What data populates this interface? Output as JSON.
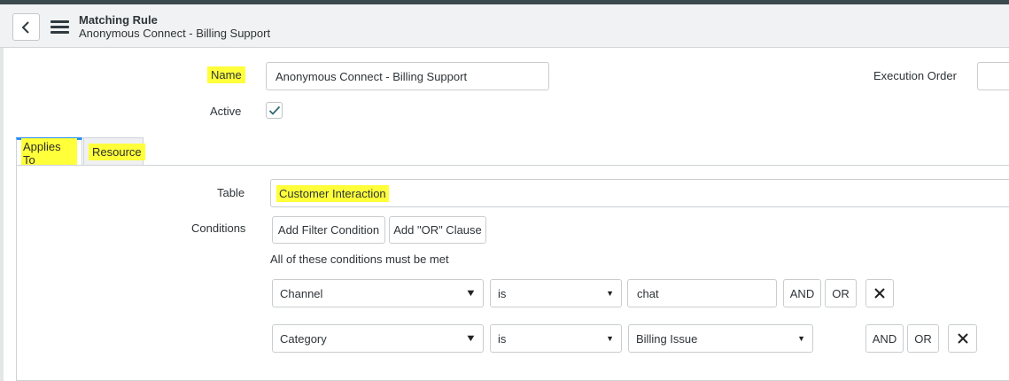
{
  "header": {
    "title": "Matching Rule",
    "subtitle": "Anonymous Connect - Billing Support"
  },
  "form": {
    "name_label": "Name",
    "name_value": "Anonymous Connect - Billing Support",
    "execution_order_label": "Execution Order",
    "execution_order_value": "",
    "active_label": "Active",
    "active_checked": true
  },
  "tabs": [
    {
      "label": "Applies To",
      "active": true
    },
    {
      "label": "Resource",
      "active": false
    }
  ],
  "applies_to": {
    "table_label": "Table",
    "table_value": "Customer Interaction",
    "conditions_label": "Conditions",
    "add_filter_label": "Add Filter Condition",
    "add_or_label": "Add \"OR\" Clause",
    "conditions_note": "All of these conditions must be met",
    "conditions": [
      {
        "field": "Channel",
        "operator": "is",
        "value": "chat",
        "and_label": "AND",
        "or_label": "OR"
      },
      {
        "field": "Category",
        "operator": "is",
        "value": "Billing Issue",
        "and_label": "AND",
        "or_label": "OR"
      }
    ]
  },
  "icons": {
    "back": "chevron-left-icon",
    "menu": "hamburger-menu-icon",
    "check": "check-icon",
    "remove": "close-icon"
  },
  "colors": {
    "highlight": "#ffff3a",
    "active_tab_accent": "#278efc",
    "header_bg": "#f0f2f3"
  }
}
